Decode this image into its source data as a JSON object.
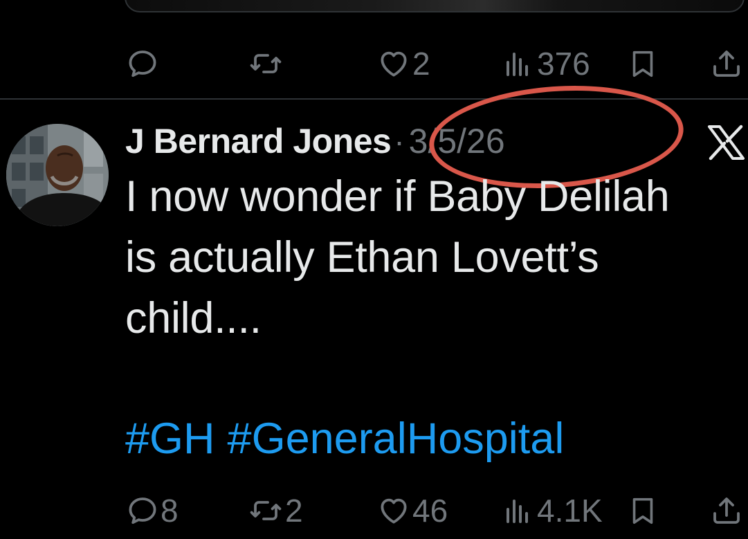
{
  "colors": {
    "background": "#000000",
    "text_primary": "#e7e9ea",
    "text_secondary": "#71767b",
    "link": "#1d9bf0",
    "divider": "#2f3336",
    "annotation": "#d9574a"
  },
  "previous_tweet": {
    "actions": {
      "reply": {
        "icon": "reply-icon",
        "count": ""
      },
      "repost": {
        "icon": "repost-icon",
        "count": ""
      },
      "like": {
        "icon": "heart-icon",
        "count": "2"
      },
      "views": {
        "icon": "views-icon",
        "count": "376"
      },
      "bookmark": {
        "icon": "bookmark-icon"
      },
      "share": {
        "icon": "share-icon"
      }
    }
  },
  "tweet": {
    "author_name": "J Bernard Jones",
    "separator": "·",
    "date": "3/5/26",
    "body_lines": [
      "I now wonder if Baby Delilah",
      "is actually Ethan Lovett’s",
      "child...."
    ],
    "hashtags": [
      "#GH",
      "#GeneralHospital"
    ],
    "actions": {
      "reply": {
        "icon": "reply-icon",
        "count": "8"
      },
      "repost": {
        "icon": "repost-icon",
        "count": "2"
      },
      "like": {
        "icon": "heart-icon",
        "count": "46"
      },
      "views": {
        "icon": "views-icon",
        "count": "4.1K"
      },
      "bookmark": {
        "icon": "bookmark-icon"
      },
      "share": {
        "icon": "share-icon"
      }
    }
  }
}
